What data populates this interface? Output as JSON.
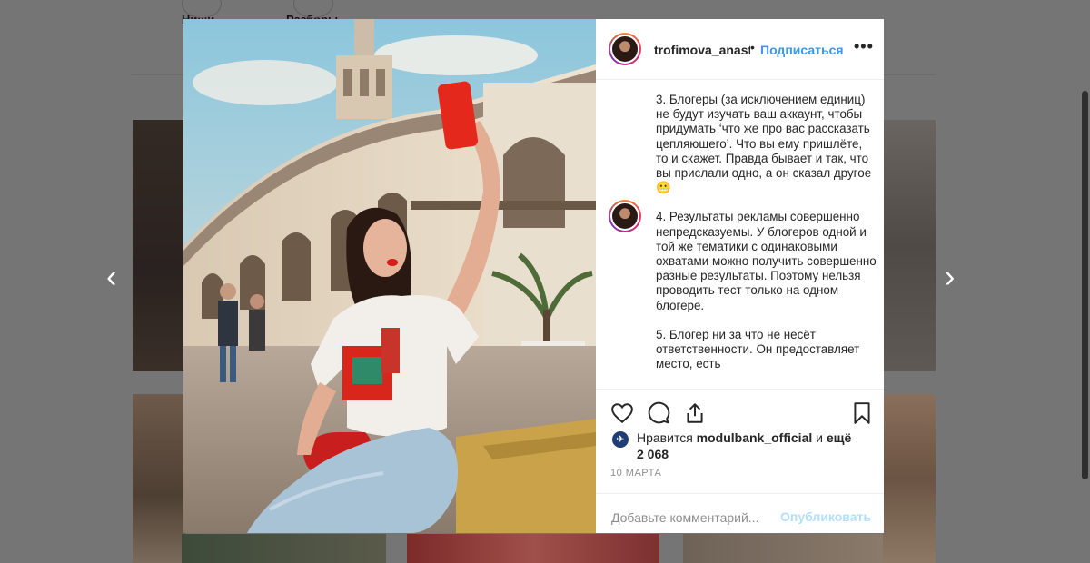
{
  "background": {
    "tabs": [
      {
        "label": "Ниши"
      },
      {
        "label": "Разборы"
      }
    ]
  },
  "post": {
    "author": "trofimova_anast",
    "separator": "•",
    "follow_label": "Подписаться",
    "more_icon": "more-horizontal-icon",
    "caption_paragraphs": [
      "3. Блогеры (за исключением единиц) не будут изучать ваш аккаунт, чтобы придумать ‘что же про вас рассказать цепляющего’. Что вы ему пришлёте, то и скажет. Правда бывает и так, что вы прислали одно, а он сказал другое 😬",
      "4. Результаты рекламы совершенно непредсказуемы. У блогеров одной и той же тематики с одинаковыми охватами можно получить совершенно разные результаты. Поэтому нельзя проводить тест только на одном блогере.",
      "5. Блогер ни за что не несёт ответственности. Он предоставляет место, есть"
    ],
    "likes_prefix": "Нравится",
    "likes_user": "modulbank_official",
    "likes_joiner": "и",
    "likes_others": "ещё 2 068",
    "date": "10 МАРТА",
    "comment_placeholder": "Добавьте комментарий...",
    "publish_label": "Опубликовать"
  },
  "navigation": {
    "prev_arrow": "‹",
    "next_arrow": "›"
  },
  "colors": {
    "accent": "#3897f0",
    "publish_disabled": "#b2dffc",
    "overlay": "#757575"
  }
}
